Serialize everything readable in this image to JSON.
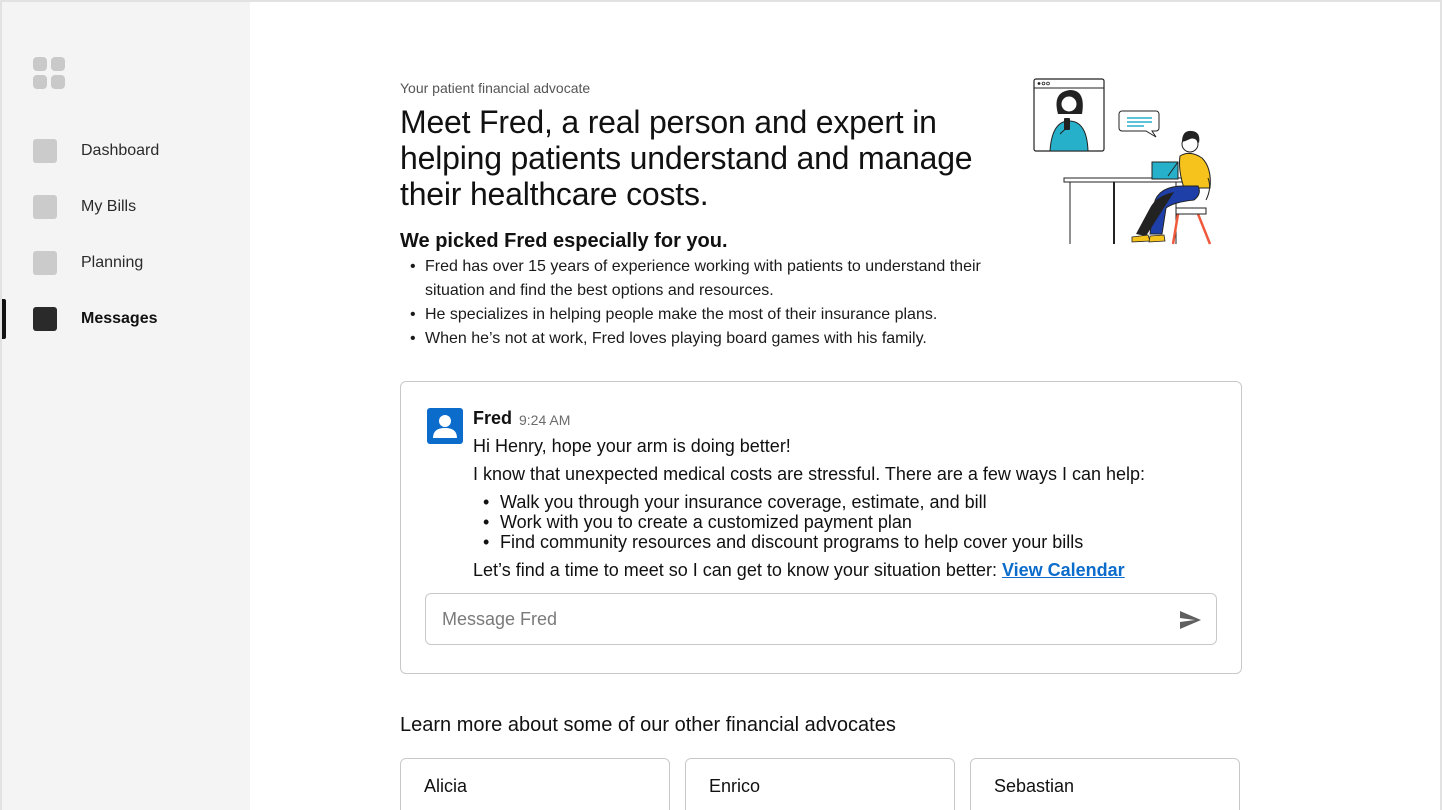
{
  "sidebar": {
    "items": [
      {
        "label": "Dashboard",
        "active": false
      },
      {
        "label": "My Bills",
        "active": false
      },
      {
        "label": "Planning",
        "active": false
      },
      {
        "label": "Messages",
        "active": true
      }
    ]
  },
  "intro": {
    "eyebrow": "Your patient financial advocate",
    "headline": "Meet Fred, a real person and expert in helping patients understand and manage their healthcare costs.",
    "subhead": "We picked Fred especially for you.",
    "facts": [
      "Fred has over 15 years of experience working with patients to understand their situation and find the best options and resources.",
      "He specializes in helping people make the most of their insurance plans.",
      "When he’s not at work, Fred loves playing board games with his family."
    ]
  },
  "chat": {
    "author": "Fred",
    "time": "9:24 AM",
    "greeting": "Hi Henry, hope your arm is doing better!",
    "intro": "I know that unexpected medical costs are stressful. There are a few ways I can help:",
    "options": [
      "Walk you through your insurance coverage, estimate, and bill",
      "Work with you to create a customized payment plan",
      "Find community resources and discount programs to help cover your bills"
    ],
    "cta_text": "Let’s find a time to meet so I can get to know your situation better: ",
    "cta_link": "View Calendar",
    "input_placeholder": "Message Fred",
    "input_value": ""
  },
  "others": {
    "title": "Learn more about some of our other financial advocates",
    "advocates": [
      {
        "name": "Alicia"
      },
      {
        "name": "Enrico"
      },
      {
        "name": "Sebastian"
      }
    ]
  },
  "colors": {
    "accent": "#0b6ccc",
    "sidebar_bg": "#f4f4f4",
    "illustration_teal": "#26b0c9",
    "illustration_yellow": "#f6c21c",
    "illustration_blue": "#1f3fa8",
    "illustration_red": "#f05a3c"
  }
}
